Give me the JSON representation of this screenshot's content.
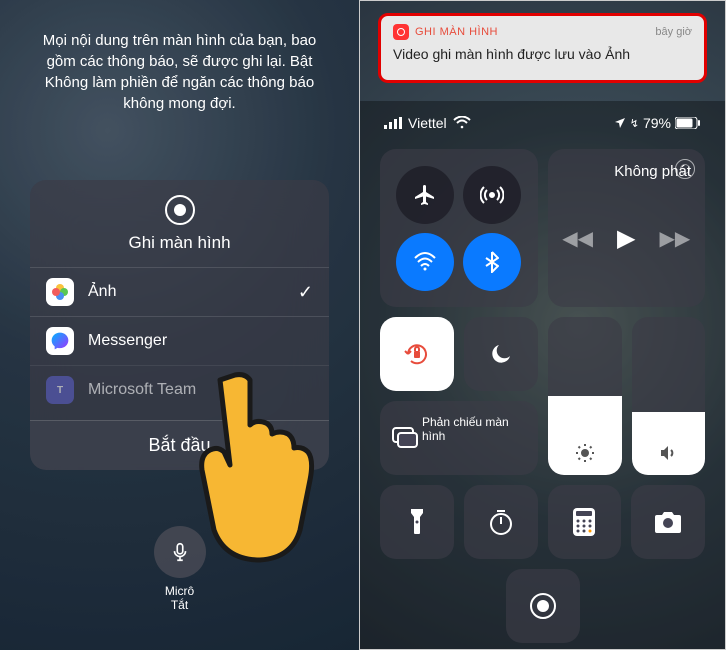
{
  "left": {
    "info_text": "Mọi nội dung trên màn hình của bạn, bao gồm các thông báo, sẽ được ghi lại. Bật Không làm phiền để ngăn các thông báo không mong đợi.",
    "card_title": "Ghi màn hình",
    "apps": [
      {
        "name": "Ảnh",
        "icon": "photos-icon",
        "selected": true
      },
      {
        "name": "Messenger",
        "icon": "messenger-icon",
        "selected": false
      },
      {
        "name": "Microsoft Team",
        "icon": "teams-icon",
        "selected": false
      }
    ],
    "start_label": "Bắt đầu",
    "mic_label": "Micrô",
    "mic_state": "Tắt"
  },
  "right": {
    "notification": {
      "app": "GHI MÀN HÌNH",
      "time": "bây giờ",
      "body": "Video ghi màn hình được lưu vào Ảnh"
    },
    "status": {
      "carrier": "Viettel",
      "battery": "79%"
    },
    "media": {
      "title": "Không phát"
    },
    "mirror_label": "Phản chiếu màn hình"
  }
}
